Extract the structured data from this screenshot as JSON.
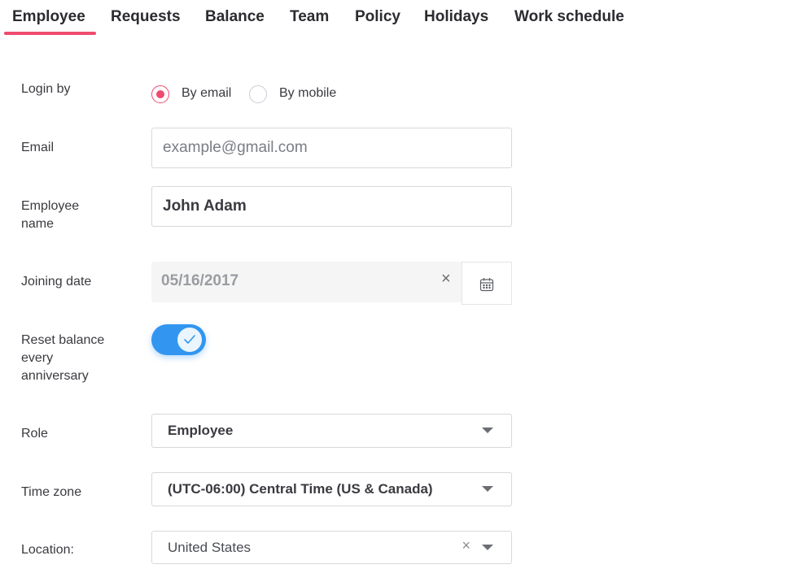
{
  "tabs": {
    "employee": "Employee",
    "requests": "Requests",
    "balance": "Balance",
    "team": "Team",
    "policy": "Policy",
    "holidays": "Holidays",
    "work_schedule": "Work schedule"
  },
  "form": {
    "login_by": {
      "label": "Login by",
      "options": [
        "By email",
        "By mobile"
      ],
      "selected": "By email"
    },
    "email": {
      "label": "Email",
      "value": "",
      "placeholder": "example@gmail.com"
    },
    "employee_name": {
      "label_line1": "Employee",
      "label_line2": "name",
      "value": "John Adam"
    },
    "joining_date": {
      "label": "Joining date",
      "value": "05/16/2017",
      "clear_icon": "×"
    },
    "reset_balance": {
      "label_line1": "Reset balance",
      "label_line2": "every",
      "label_line3": "anniversary",
      "enabled": true
    },
    "role": {
      "label": "Role",
      "value": "Employee"
    },
    "time_zone": {
      "label": "Time zone",
      "value": "(UTC-06:00) Central Time (US & Canada)"
    },
    "location": {
      "label": "Location:",
      "value": "United States",
      "clear_icon": "×"
    }
  },
  "colors": {
    "accent": "#ef4b6e",
    "toggle": "#3296f0"
  }
}
